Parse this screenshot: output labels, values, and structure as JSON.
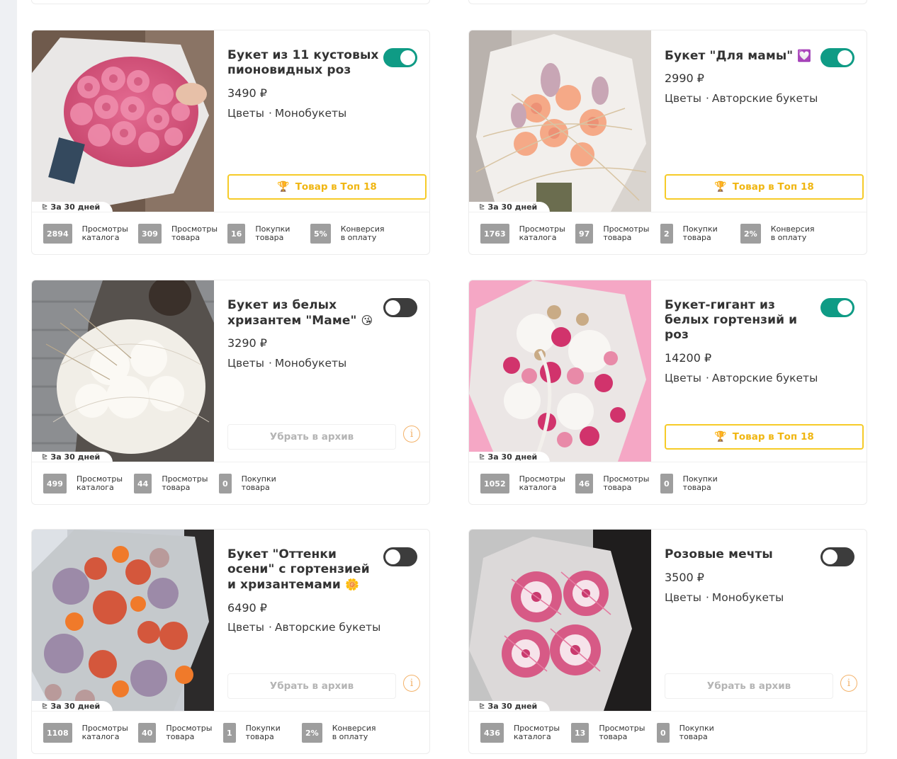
{
  "common": {
    "period_label": "За 30 дней",
    "top_button_label": "Товар в Топ 18",
    "archive_button_label": "Убрать в архив",
    "info_icon_glyph": "i",
    "stat_labels": {
      "catalog_views": [
        "Просмотры",
        "каталога"
      ],
      "product_views": [
        "Просмотры",
        "товара"
      ],
      "purchases": [
        "Покупки",
        "товара"
      ],
      "conversion": [
        "Конверсия",
        "в оплату"
      ]
    }
  },
  "products": [
    {
      "title": "Букет из 11 кустовых пионовидных роз",
      "emoji": "",
      "price": "3490 ₽",
      "category": "Цветы",
      "subcategory": "Монобукеты",
      "active": true,
      "action": "top",
      "stats": {
        "catalog_views": "2894",
        "product_views": "309",
        "purchases": "16",
        "conversion": "5%"
      }
    },
    {
      "title": "Букет \"Для мамы\"",
      "emoji": "💟",
      "price": "2990 ₽",
      "category": "Цветы",
      "subcategory": "Авторские букеты",
      "active": true,
      "action": "top",
      "stats": {
        "catalog_views": "1763",
        "product_views": "97",
        "purchases": "2",
        "conversion": "2%"
      }
    },
    {
      "title": "Букет из белых хризантем \"Маме\"",
      "emoji": "😘",
      "price": "3290 ₽",
      "category": "Цветы",
      "subcategory": "Монобукеты",
      "active": false,
      "action": "archive",
      "stats": {
        "catalog_views": "499",
        "product_views": "44",
        "purchases": "0"
      }
    },
    {
      "title": "Букет-гигант из белых гортензий и роз",
      "emoji": "",
      "price": "14200 ₽",
      "category": "Цветы",
      "subcategory": "Авторские букеты",
      "active": true,
      "action": "top",
      "stats": {
        "catalog_views": "1052",
        "product_views": "46",
        "purchases": "0"
      }
    },
    {
      "title": "Букет \"Оттенки осени\" с гортензией и хризантемами",
      "emoji": "🌼",
      "price": "6490 ₽",
      "category": "Цветы",
      "subcategory": "Авторские букеты",
      "active": false,
      "action": "archive",
      "stats": {
        "catalog_views": "1108",
        "product_views": "40",
        "purchases": "1",
        "conversion": "2%"
      }
    },
    {
      "title": "Розовые мечты",
      "emoji": "",
      "price": "3500 ₽",
      "category": "Цветы",
      "subcategory": "Монобукеты",
      "active": false,
      "action": "archive",
      "stats": {
        "catalog_views": "436",
        "product_views": "13",
        "purchases": "0"
      }
    }
  ],
  "colors": {
    "toggle_on": "#0f9b85",
    "toggle_off": "#3c3c3c",
    "top_button_border": "#f6cb28",
    "top_button_text": "#f0b612",
    "info_icon": "#f3b26a",
    "stat_badge": "#9e9e9e"
  }
}
